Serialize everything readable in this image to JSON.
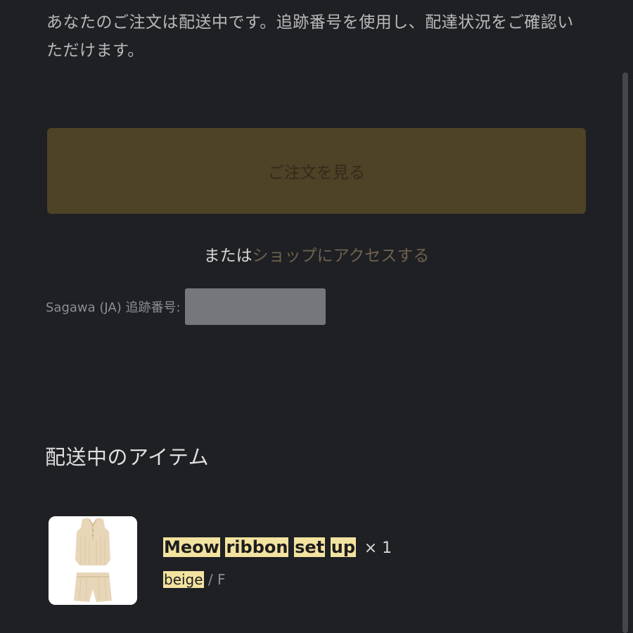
{
  "intro": {
    "message": "あなたのご注文は配送中です。追跡番号を使用し、配達状況をご確認いただけます。"
  },
  "actions": {
    "view_order_label": "ご注文を見る",
    "alt_prefix": "または",
    "shop_link_label": "ショップにアクセスする"
  },
  "tracking": {
    "label": "Sagawa (JA) 追跡番号:"
  },
  "items_section": {
    "title": "配送中のアイテム",
    "items": [
      {
        "name_words": [
          "Meow",
          "ribbon",
          "set",
          "up"
        ],
        "quantity": "× 1",
        "color": "beige",
        "size_separator": "/",
        "size": "F"
      }
    ]
  },
  "colors": {
    "background": "#1f2024",
    "button_background": "#4e4227",
    "highlight": "#f3e3a0",
    "link": "#6e6150"
  }
}
